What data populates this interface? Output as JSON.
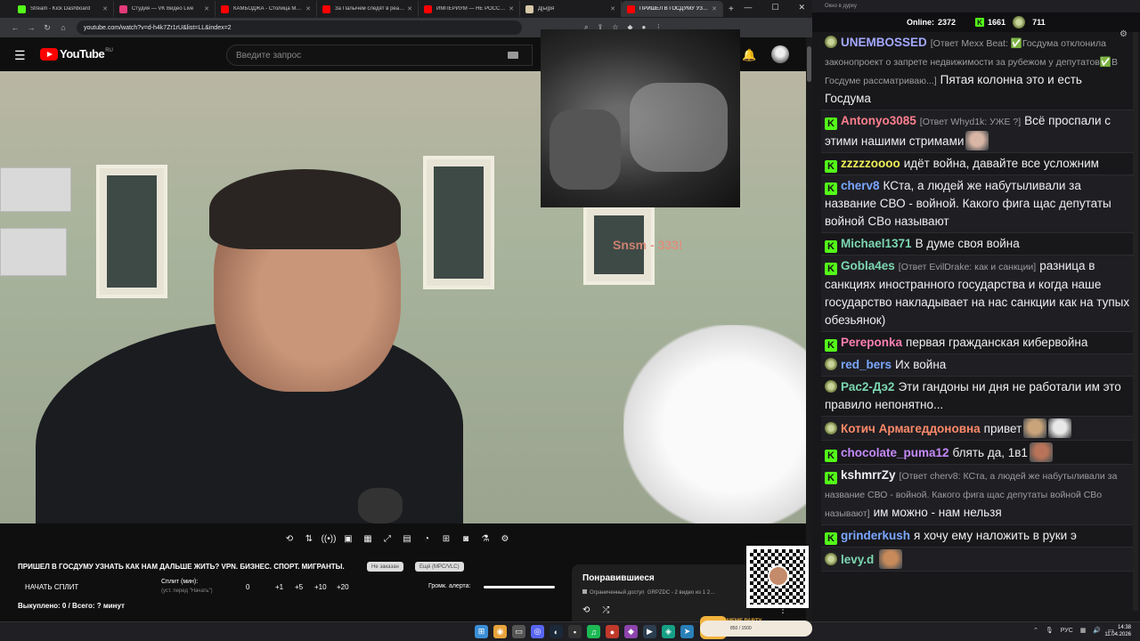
{
  "browser": {
    "tabs": [
      {
        "label": "Stream - Kick Dashboard",
        "color": "#53fc18"
      },
      {
        "label": "Студия — VK Видео Live",
        "color": "#e33a7a"
      },
      {
        "label": "КАМБОДЖА - Столица Ми…",
        "color": "#ff0000"
      },
      {
        "label": "За Палычем следят в реал…",
        "color": "#ff0000"
      },
      {
        "label": "ИМПЕРИУМ — НЕ РОССИЯ…",
        "color": "#ff0000"
      },
      {
        "label": "Д[ы]ря",
        "color": "#d8c9a8"
      },
      {
        "label": "ПРИШЕЛ В ГОСДУМУ УЗНА…",
        "color": "#ff0000",
        "active": true
      }
    ],
    "url": "youtube.com/watch?v=d-h4k7Zr1rU&list=LL&index=2"
  },
  "youtube": {
    "logo": "YouTube",
    "region": "RU",
    "search_placeholder": "Введите запрос"
  },
  "video": {
    "overlay_text": "Snsm - 333!"
  },
  "controls": {
    "title": "ПРИШЕЛ В ГОСДУМУ УЗНАТЬ КАК НАМ ДАЛЬШЕ ЖИТЬ? VPN. БИЗНЕС. СПОРТ. МИГРАНТЫ.",
    "tag1": "Не заказан",
    "tag2": "Ещё (MPC/VLC)",
    "split_button": "НАЧАТЬ СПЛИТ",
    "split_label": "Сплит (мин):",
    "split_hint": "(уст. перед \"Начать\")",
    "split_value": "0",
    "inc": [
      "+1",
      "+5",
      "+10",
      "+20"
    ],
    "volume_label": "Громк. алерта:",
    "bought": "Выкуплено: 0 / Всего: ? минут"
  },
  "liked": {
    "title": "Понравившиеся",
    "access": "Ограниченный доступ",
    "meta": "GRPZDC - 2 видео из 1 2…"
  },
  "chat": {
    "window_title": "Окно в дурку",
    "online_label": "Online:",
    "online": "2372",
    "kick_count": "1661",
    "yt_count": "711",
    "messages": [
      {
        "badge": "cat",
        "user": "UNEMBOSSED",
        "color": "#a3a8ff",
        "reply": "[Ответ Mexx Beat: ✅Госдума отклонила законопроект о запрете недвижимости за рубежом у депутатов✅В Госдуме рассматриваю...]",
        "text": "Пятая колонна это и есть Госдума",
        "alt": false
      },
      {
        "badge": "kick",
        "user": "Antonyo3085",
        "color": "#ff7f8e",
        "reply": "[Ответ Whyd1k: УЖЕ ?]",
        "text": "Всё проспали с этими нашими стримами",
        "emote": "#d8b5a5",
        "alt": true
      },
      {
        "badge": "kick",
        "user": "zzzzzoooo",
        "color": "#f0f05a",
        "reply": "",
        "text": "идёт война, давайте все усложним",
        "alt": false
      },
      {
        "badge": "kick",
        "user": "cherv8",
        "color": "#7aa7ff",
        "reply": "",
        "text": "КСта, а людей же набутыливали за название СВО - войной. Какого фига щас депутаты войной СВо называют",
        "alt": true
      },
      {
        "badge": "kick",
        "user": "Michael1371",
        "color": "#7cd6b0",
        "reply": "",
        "text": "В думе своя война",
        "alt": false
      },
      {
        "badge": "kick",
        "user": "Gobla4es",
        "color": "#7cd6b0",
        "reply": "[Ответ EvilDrake: как и санкции]",
        "text": "разница в санкциях иностранного государства и когда наше государство накладывает на нас санкции как на тупых обезьянок)",
        "alt": true
      },
      {
        "badge": "kick",
        "user": "Pereponka",
        "color": "#ff7fb0",
        "reply": "",
        "text": "первая гражданская кибервойна",
        "alt": false
      },
      {
        "badge": "cat",
        "user": "red_bers",
        "color": "#7aa7ff",
        "reply": "",
        "text": "Их война",
        "alt": true
      },
      {
        "badge": "cat",
        "user": "Рас2-Дэ2",
        "color": "#7cd6b0",
        "reply": "",
        "text": "Эти гандоны ни дня не работали им это правило непонятно...",
        "alt": false
      },
      {
        "badge": "cat",
        "user": "Котич Армагеддоновна",
        "color": "#ff8a6a",
        "reply": "",
        "text": "привет",
        "emote": "#c9a47a",
        "emote2": "#e8e8e8",
        "alt": true
      },
      {
        "badge": "kick",
        "user": "chocolate_puma12",
        "color": "#c58af9",
        "reply": "",
        "text": "блять да, 1в1",
        "emote": "#b87358",
        "alt": false
      },
      {
        "badge": "kick",
        "user": "kshmrrZy",
        "color": "#efeff1",
        "reply": "[Ответ cherv8: КСта, а людей же набутыливали за название СВО - войной. Какого фига щас депутаты войной СВо называют]",
        "text": "им можно - нам нельзя",
        "alt": true
      },
      {
        "badge": "kick",
        "user": "grinderkush",
        "color": "#7aa7ff",
        "reply": "",
        "text": "я хочу ему наложить в руки э",
        "alt": false
      },
      {
        "badge": "cat",
        "user": "levy.d",
        "color": "#7cd6b0",
        "reply": "",
        "text": "",
        "emote": "#c88a5a",
        "alt": true
      }
    ]
  },
  "meme": {
    "title": "MEME PARTY",
    "progress": "850 / 1500"
  },
  "taskbar": {
    "lang": "РУС",
    "time": "14:38",
    "date": "11.04.2026"
  }
}
